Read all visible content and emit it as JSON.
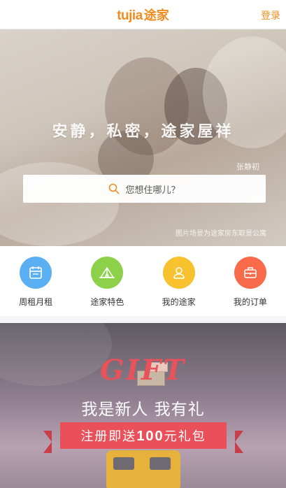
{
  "header": {
    "logo_latin": "tujia",
    "logo_cn": "途家",
    "login_label": "登录"
  },
  "hero": {
    "slogan": "安静，私密，途家屋祥",
    "name_tag": "张静初",
    "credit": "图片场景为途家房东取景公寓"
  },
  "search": {
    "placeholder": "您想住哪儿？"
  },
  "quick_links": [
    {
      "label": "周租月租",
      "color": "#5aaef2",
      "icon": "calendar-icon"
    },
    {
      "label": "途家特色",
      "color": "#8dd04a",
      "icon": "tent-icon"
    },
    {
      "label": "我的途家",
      "color": "#f7c22d",
      "icon": "user-icon"
    },
    {
      "label": "我的订单",
      "color": "#f86a4a",
      "icon": "briefcase-icon"
    }
  ],
  "banner": {
    "gift_word": "GIFT",
    "title": "我是新人 我有礼",
    "ribbon_prefix": "注册即送",
    "ribbon_amount": "100",
    "ribbon_suffix": "元礼包"
  },
  "colors": {
    "brand": "#f18d1f",
    "ribbon": "#e9505a"
  }
}
